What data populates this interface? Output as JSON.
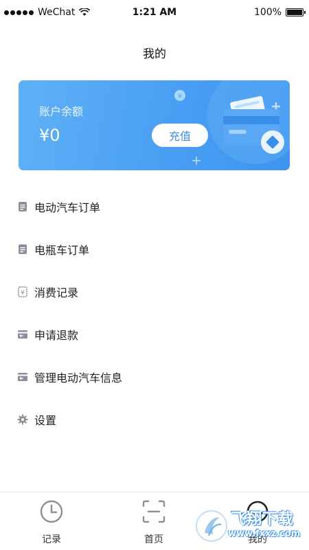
{
  "status_bar": {
    "carrier": "WeChat",
    "time": "1:21 AM",
    "battery": "100%"
  },
  "page": {
    "title": "我的"
  },
  "balance_card": {
    "label": "账户余额",
    "amount": "¥0",
    "recharge_label": "充值"
  },
  "menu": {
    "items": [
      {
        "label": "电动汽车订单",
        "icon": "document-icon"
      },
      {
        "label": "电瓶车订单",
        "icon": "document-icon"
      },
      {
        "label": "消费记录",
        "icon": "receipt-yen-icon"
      },
      {
        "label": "申请退款",
        "icon": "card-refund-icon"
      },
      {
        "label": "管理电动汽车信息",
        "icon": "card-manage-icon"
      },
      {
        "label": "设置",
        "icon": "gear-icon"
      }
    ]
  },
  "tab_bar": {
    "tabs": [
      {
        "label": "记录",
        "icon": "clock-icon"
      },
      {
        "label": "首页",
        "icon": "scan-frame-icon"
      },
      {
        "label": "我的",
        "icon": "smiley-icon"
      }
    ]
  },
  "watermark": {
    "text": "飞翔下载",
    "url": "www.fxxz.com"
  },
  "colors": {
    "accent": "#3f94f0",
    "card_gradient_start": "#5fb1f6",
    "icon_gray": "#8a8f99"
  }
}
